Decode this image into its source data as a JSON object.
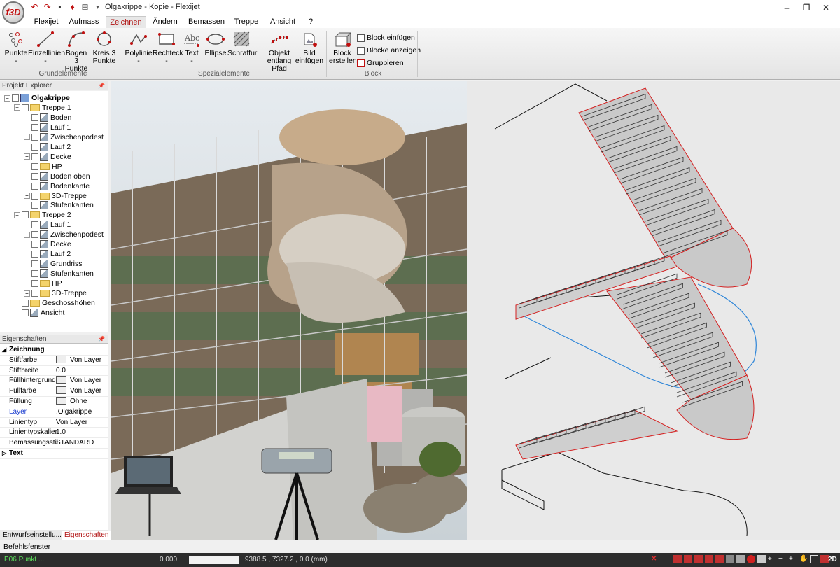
{
  "app": {
    "logo": "f3D",
    "title": "Olgakrippe - Kopie - Flexijet",
    "window_buttons": [
      "–",
      "❐",
      "✕"
    ]
  },
  "quick_access": [
    "undo-icon",
    "redo-icon",
    "save-icon",
    "pin-icon",
    "gamepad-icon",
    "dropdown-icon"
  ],
  "menu_tabs": [
    "Flexijet",
    "Aufmass",
    "Zeichnen",
    "Ändern",
    "Bemassen",
    "Treppe",
    "Ansicht",
    "?"
  ],
  "active_tab": "Zeichnen",
  "ribbon": {
    "buttons": [
      {
        "label": "Punkte",
        "sub": "-",
        "icon": "points-icon"
      },
      {
        "label": "Einzellinien",
        "sub": "-",
        "icon": "line-icon"
      },
      {
        "label": "Bogen 3",
        "sub": "Punkte",
        "icon": "arc-icon"
      },
      {
        "label": "Kreis 3",
        "sub": "Punkte",
        "icon": "circle-icon"
      },
      {
        "label": "Polylinie",
        "sub": "-",
        "icon": "polyline-icon"
      },
      {
        "label": "Rechteck",
        "sub": "-",
        "icon": "rectangle-icon"
      },
      {
        "label": "Text",
        "sub": "-",
        "icon": "text-icon"
      },
      {
        "label": "Ellipse",
        "sub": "",
        "icon": "ellipse-icon"
      },
      {
        "label": "Schraffur",
        "sub": "",
        "icon": "hatch-icon"
      },
      {
        "label": "Objekt",
        "sub": "entlang Pfad",
        "icon": "path-object-icon"
      },
      {
        "label": "Bild",
        "sub": "einfügen",
        "icon": "image-insert-icon"
      },
      {
        "label": "Block",
        "sub": "erstellen",
        "icon": "block-create-icon"
      }
    ],
    "small_buttons": [
      "Block einfügen",
      "Blöcke anzeigen",
      "Gruppieren"
    ],
    "groups": [
      "Grundelemente",
      "Spezialelemente",
      "Block"
    ]
  },
  "explorer": {
    "header": "Projekt Explorer",
    "pin": "📌",
    "items": [
      {
        "label": "Olgakrippe",
        "level": 0,
        "kind": "project",
        "expander": "−",
        "bold": true
      },
      {
        "label": "Treppe 1",
        "level": 1,
        "kind": "folder",
        "expander": "−"
      },
      {
        "label": "Boden",
        "level": 2,
        "kind": "doc",
        "expander": ""
      },
      {
        "label": "Lauf 1",
        "level": 2,
        "kind": "doc",
        "expander": ""
      },
      {
        "label": "Zwischenpodest",
        "level": 2,
        "kind": "doc",
        "expander": "+"
      },
      {
        "label": "Lauf 2",
        "level": 2,
        "kind": "doc",
        "expander": ""
      },
      {
        "label": "Decke",
        "level": 2,
        "kind": "doc",
        "expander": "+"
      },
      {
        "label": "HP",
        "level": 2,
        "kind": "folder",
        "expander": ""
      },
      {
        "label": "Boden oben",
        "level": 2,
        "kind": "doc",
        "expander": ""
      },
      {
        "label": "Bodenkante",
        "level": 2,
        "kind": "doc",
        "expander": ""
      },
      {
        "label": "3D-Treppe",
        "level": 2,
        "kind": "folder",
        "expander": "+"
      },
      {
        "label": "Stufenkanten",
        "level": 2,
        "kind": "doc",
        "expander": ""
      },
      {
        "label": "Treppe 2",
        "level": 1,
        "kind": "folder",
        "expander": "−"
      },
      {
        "label": "Lauf 1",
        "level": 2,
        "kind": "doc",
        "expander": ""
      },
      {
        "label": "Zwischenpodest",
        "level": 2,
        "kind": "doc",
        "expander": "+"
      },
      {
        "label": "Decke",
        "level": 2,
        "kind": "doc",
        "expander": ""
      },
      {
        "label": "Lauf 2",
        "level": 2,
        "kind": "doc",
        "expander": ""
      },
      {
        "label": "Grundriss",
        "level": 2,
        "kind": "doc",
        "expander": ""
      },
      {
        "label": "Stufenkanten",
        "level": 2,
        "kind": "doc",
        "expander": ""
      },
      {
        "label": "HP",
        "level": 2,
        "kind": "folder",
        "expander": ""
      },
      {
        "label": "3D-Treppe",
        "level": 2,
        "kind": "folder",
        "expander": "+"
      },
      {
        "label": "Geschosshöhen",
        "level": 1,
        "kind": "folder",
        "expander": ""
      },
      {
        "label": "Ansicht",
        "level": 1,
        "kind": "doc",
        "expander": ""
      }
    ]
  },
  "properties": {
    "header": "Eigenschaften",
    "pin": "📌",
    "rows": [
      {
        "key": "Zeichnung",
        "value": "",
        "category": true,
        "expander": "◢"
      },
      {
        "key": "Stiftfarbe",
        "value": "Von Layer",
        "swatch": true
      },
      {
        "key": "Stiftbreite",
        "value": "0.0"
      },
      {
        "key": "Füllhintergrund",
        "value": "Von Layer",
        "swatch": true
      },
      {
        "key": "Füllfarbe",
        "value": "Von Layer",
        "swatch": true
      },
      {
        "key": "Füllung",
        "value": "Ohne",
        "swatch": true
      },
      {
        "key": "Layer",
        "value": ".Olgakrippe",
        "highlight": true
      },
      {
        "key": "Linientyp",
        "value": "Von Layer"
      },
      {
        "key": "Linientypskalier",
        "value": "1.0"
      },
      {
        "key": "Bemassungsstil",
        "value": "STANDARD"
      },
      {
        "key": "Text",
        "value": "",
        "category": true,
        "expander": "▷"
      }
    ],
    "tabs": [
      "Entwurfseinstellu...",
      "Eigenschaften"
    ]
  },
  "command_window": "Befehlsfenster",
  "status": {
    "mode": "P06 Punkt ...",
    "value": "0.000",
    "coords": "9388.5 , 7327.2 , 0.0 (mm)",
    "view": "2D"
  },
  "colors": {
    "accent": "#b01010",
    "stair_red": "#d42020",
    "path_blue": "#2f86d8",
    "status_green": "#5be05b"
  }
}
